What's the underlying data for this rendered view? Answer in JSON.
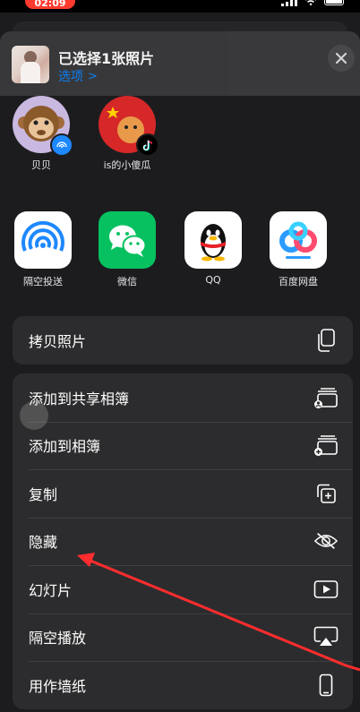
{
  "status_bar": {
    "time": "02:09"
  },
  "header": {
    "title": "已选择1张照片",
    "options_label": "选项",
    "options_chevron": ">"
  },
  "contacts": [
    {
      "name": "贝贝",
      "avatar_icon": "monkey-avatar-icon",
      "badge_icon": "airdrop-badge-icon"
    },
    {
      "name": "is的小傻瓜",
      "avatar_icon": "flag-avatar-icon",
      "badge_icon": "tiktok-badge-icon"
    }
  ],
  "apps": [
    {
      "label": "隔空投送",
      "icon": "airdrop-icon",
      "color": "#1e88ff"
    },
    {
      "label": "微信",
      "icon": "wechat-icon",
      "color": "#07c160"
    },
    {
      "label": "QQ",
      "icon": "qq-icon",
      "color": "#000000"
    },
    {
      "label": "百度网盘",
      "icon": "baidu-netdisk-icon",
      "color": "#2b9bff"
    }
  ],
  "action_groups": [
    [
      {
        "label": "拷贝照片",
        "icon": "copy-photo-icon"
      }
    ],
    [
      {
        "label": "添加到共享相簿",
        "icon": "shared-album-icon"
      },
      {
        "label": "添加到相簿",
        "icon": "add-album-icon"
      },
      {
        "label": "复制",
        "icon": "duplicate-icon"
      },
      {
        "label": "隐藏",
        "icon": "eye-slash-icon"
      },
      {
        "label": "幻灯片",
        "icon": "slideshow-icon"
      },
      {
        "label": "隔空播放",
        "icon": "airplay-icon"
      },
      {
        "label": "用作墙纸",
        "icon": "phone-wallpaper-icon"
      }
    ]
  ],
  "colors": {
    "accent": "#0a84ff",
    "sheet_bg": "#1c1c1e",
    "row_bg": "#2c2c2e",
    "annotation_arrow": "#ff2d2d"
  }
}
